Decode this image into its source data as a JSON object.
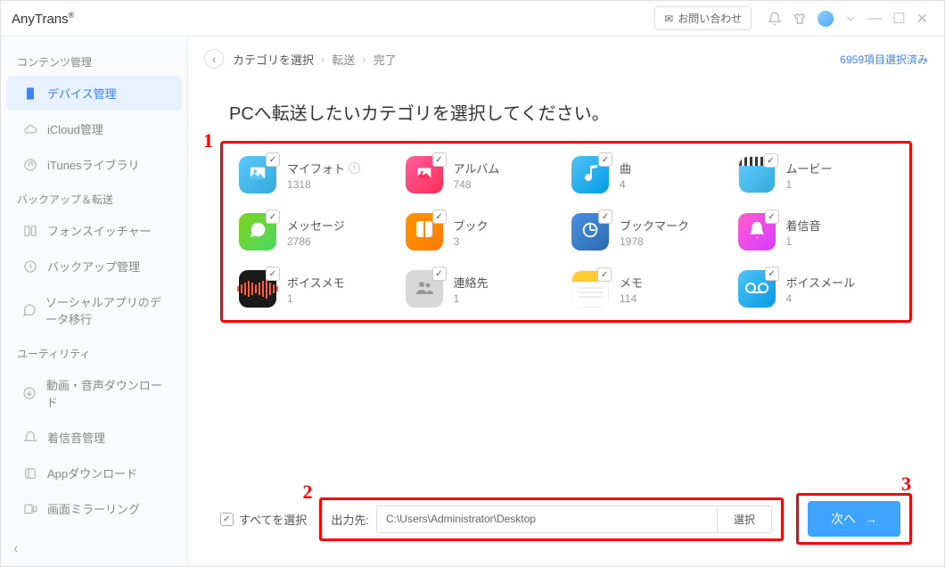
{
  "app": {
    "title": "AnyTrans",
    "reg": "®"
  },
  "titlebar": {
    "contact": "お問い合わせ"
  },
  "sidebar": {
    "sections": {
      "content": "コンテンツ管理",
      "backup": "バックアップ＆転送",
      "utility": "ユーティリティ"
    },
    "items": {
      "device": "デバイス管理",
      "icloud": "iCloud管理",
      "itunes": "iTunesライブラリ",
      "phoneswitch": "フォンスイッチャー",
      "backupmgr": "バックアップ管理",
      "socialapp": "ソーシャルアプリのデータ移行",
      "mediadownload": "動画・音声ダウンロード",
      "ringtonemgr": "着信音管理",
      "appdownload": "Appダウンロード",
      "screenmirror": "画面ミラーリング"
    }
  },
  "breadcrumb": {
    "step1": "カテゴリを選択",
    "step2": "転送",
    "step3": "完了",
    "selected": "6959項目選択済み"
  },
  "heading": "PCへ転送したいカテゴリを選択してください。",
  "categories": [
    {
      "key": "photos",
      "label": "マイフォト",
      "count": "1318",
      "info": true
    },
    {
      "key": "albums",
      "label": "アルバム",
      "count": "748"
    },
    {
      "key": "music",
      "label": "曲",
      "count": "4"
    },
    {
      "key": "movies",
      "label": "ムービー",
      "count": "1"
    },
    {
      "key": "messages",
      "label": "メッセージ",
      "count": "2786"
    },
    {
      "key": "books",
      "label": "ブック",
      "count": "3"
    },
    {
      "key": "bookmarks",
      "label": "ブックマーク",
      "count": "1978"
    },
    {
      "key": "ringtones",
      "label": "着信音",
      "count": "1"
    },
    {
      "key": "voicememo",
      "label": "ボイスメモ",
      "count": "1"
    },
    {
      "key": "contacts",
      "label": "連絡先",
      "count": "1"
    },
    {
      "key": "notes",
      "label": "メモ",
      "count": "114"
    },
    {
      "key": "voicemail",
      "label": "ボイスメール",
      "count": "4"
    }
  ],
  "footer": {
    "select_all": "すべてを選択",
    "output_label": "出力先:",
    "output_path": "C:\\Users\\Administrator\\Desktop",
    "browse": "選択",
    "next": "次へ"
  },
  "annotations": {
    "a1": "1",
    "a2": "2",
    "a3": "3"
  }
}
